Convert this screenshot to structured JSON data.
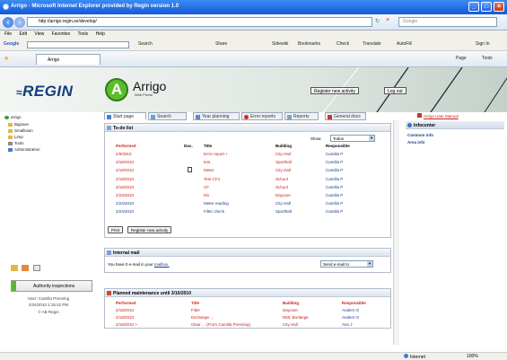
{
  "window": {
    "title": "Arrigo - Microsoft Internet Explorer provided by Regin version 1.0"
  },
  "addr": {
    "url": "http://arrigo.regin.se/develop/",
    "search_placeholder": "Google"
  },
  "menu": [
    "File",
    "Edit",
    "View",
    "Favorites",
    "Tools",
    "Help"
  ],
  "google": {
    "label": "Google",
    "items": [
      "Search",
      "Share",
      "Sidewiki",
      "Bookmarks",
      "Check",
      "Translate",
      "AutoFill",
      "Sign In"
    ]
  },
  "ietab": {
    "label": "Arrigo",
    "right_items": [
      "Page",
      "Tools"
    ]
  },
  "header": {
    "brand": "REGIN",
    "logo_letter": "A",
    "app": "Arrigo",
    "subtitle": "Web Portal",
    "register_btn": "Register new activity",
    "logout_btn": "Log out"
  },
  "tabs": [
    {
      "label": "Start page"
    },
    {
      "label": "Search"
    },
    {
      "label": "Year planning"
    },
    {
      "label": "Error reports"
    },
    {
      "label": "Reports"
    },
    {
      "label": "General docs"
    }
  ],
  "tree": [
    "arrigo",
    "Bigtown",
    "Smalltown",
    "Limp",
    "Tools",
    "Administration"
  ],
  "left": {
    "auth_btn": "Authority inspections",
    "user": "User: Camilla Prenning",
    "datetime": "2/24/2010 2:15:42 PM",
    "copyright": "© AB Regin"
  },
  "todo": {
    "title": "To-do list",
    "show_label": "Show:",
    "show_value": "Todos",
    "columns": [
      "Performed",
      "Doc.",
      "Title",
      "Building",
      "Responsible"
    ],
    "rows": [
      {
        "performed": "2/9/2010",
        "title": "Error report +",
        "building": "City Hall",
        "responsible": "Camilla P",
        "red": true
      },
      {
        "performed": "2/18/2010",
        "title": "test",
        "building": "Sporthall",
        "responsible": "Camilla P",
        "red": true
      },
      {
        "performed": "2/18/2010",
        "title": "Meter",
        "building": "City Hall",
        "responsible": "Camilla P",
        "red": true
      },
      {
        "performed": "2/18/2010",
        "title": "Test CF4",
        "building": "School",
        "responsible": "Camilla P",
        "red": true
      },
      {
        "performed": "2/18/2010",
        "title": "CF",
        "building": "School",
        "responsible": "Camilla P",
        "red": true
      },
      {
        "performed": "2/23/2010",
        "title": "M1",
        "building": "Daycare",
        "responsible": "Camilla P",
        "red": true
      },
      {
        "performed": "2/24/2010",
        "title": "Meter reading",
        "building": "City Hall",
        "responsible": "Camilla P",
        "red": false
      },
      {
        "performed": "2/24/2010",
        "title": "Filter check",
        "building": "Sporthall",
        "responsible": "Camilla P",
        "red": false
      }
    ],
    "print_btn": "Print",
    "register_btn": "Register new activity"
  },
  "mail": {
    "title": "Internal mail",
    "text_before": "You have 0 e-mail in your",
    "link": "mailbox.",
    "select": "Send e-mail to"
  },
  "maint": {
    "title": "Planned maintenance until 3/10/2010",
    "columns": [
      "Performed",
      "Title",
      "Building",
      "Responsible"
    ],
    "rows": [
      {
        "performed": "2/18/2010",
        "title": "Filter",
        "building": "Daycare",
        "responsible": "Anders O"
      },
      {
        "performed": "2/18/2010",
        "title": "Exchange ...",
        "building": "DML Borlänge",
        "responsible": "Anders O"
      },
      {
        "performed": "2/18/2010 >",
        "title": "Clear ... (From Camilla Prenning)",
        "building": "City Hall",
        "responsible": "Ann J"
      }
    ]
  },
  "right": {
    "manual": "Arrigo User Manual",
    "infocenter": "Infocenter",
    "links": [
      "Common info",
      "Area info"
    ]
  },
  "status": {
    "zone": "Internet",
    "zoom": "100%"
  },
  "colors": {
    "red": "#c4221b",
    "blue": "#1c3b8a",
    "green": "#5cbd2c",
    "navy": "#133d7d"
  }
}
